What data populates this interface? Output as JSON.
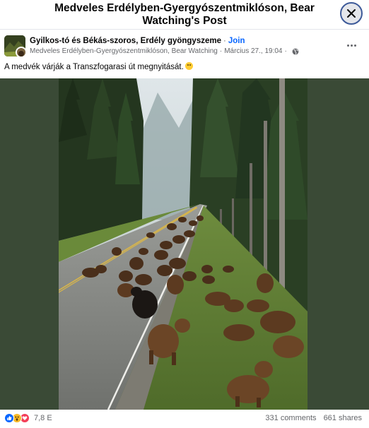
{
  "dialog": {
    "title": "Medveles Erdélyben-Gyergyószentmiklóson, Bear Watching's Post"
  },
  "post": {
    "group_name": "Gyilkos-tó és Békás-szoros, Erdély gyöngyszeme",
    "join_label": "Join",
    "page_name": "Medveles Erdélyben-Gyergyószentmiklóson, Bear Watching",
    "timestamp": "Március 27., 19:04",
    "text": "A medvék várják a Transzfogarasi út megnyitását."
  },
  "footer": {
    "reaction_count": "7,8 E",
    "comments": "331 comments",
    "shares": "661 shares"
  },
  "icons": {
    "close": "close-icon",
    "globe": "globe-icon",
    "more": "more-options-icon",
    "like": "like-reaction-icon",
    "wow": "wow-reaction-icon",
    "love": "love-reaction-icon"
  },
  "colors": {
    "accent": "#0866ff",
    "secondary_text": "#65676b",
    "media_background": "#3a4a36"
  }
}
